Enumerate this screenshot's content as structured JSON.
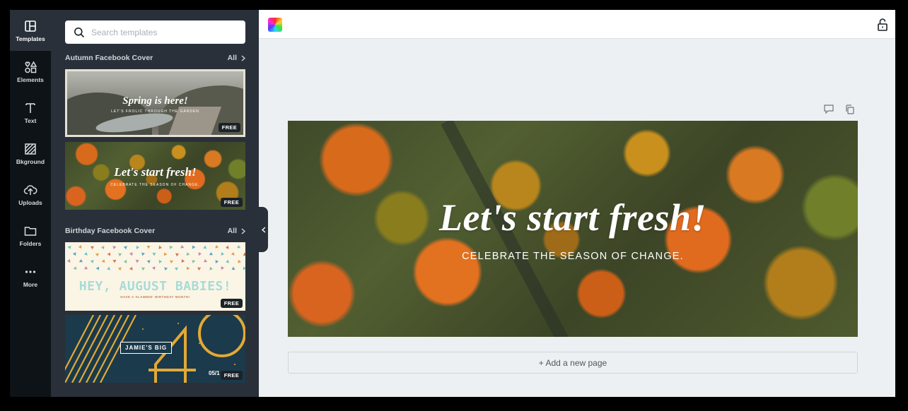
{
  "rail": {
    "items": [
      {
        "label": "Templates",
        "icon": "templates-icon",
        "active": true
      },
      {
        "label": "Elements",
        "icon": "elements-icon"
      },
      {
        "label": "Text",
        "icon": "text-icon"
      },
      {
        "label": "Bkground",
        "icon": "background-icon"
      },
      {
        "label": "Uploads",
        "icon": "upload-icon"
      },
      {
        "label": "Folders",
        "icon": "folder-icon"
      },
      {
        "label": "More",
        "icon": "more-icon"
      }
    ]
  },
  "search": {
    "placeholder": "Search templates"
  },
  "sections": [
    {
      "title": "Autumn Facebook Cover",
      "see_all": "All",
      "templates": [
        {
          "title": "Spring is here!",
          "subtitle": "LET'S FROLIC THROUGH THE GARDEN",
          "badge": "FREE"
        },
        {
          "title": "Let's start fresh!",
          "subtitle": "CELEBRATE THE SEASON OF CHANGE.",
          "badge": "FREE"
        }
      ]
    },
    {
      "title": "Birthday Facebook Cover",
      "see_all": "All",
      "templates": [
        {
          "title": "HEY, AUGUST BABIES!",
          "subtitle": "HAVE A SLAMMIN' BIRTHDAY MONTH!",
          "badge": "FREE"
        },
        {
          "title": "JAMIE'S BIG",
          "number": "40",
          "date": "05/1",
          "badge": "FREE"
        }
      ]
    }
  ],
  "canvas": {
    "title": "Let's start fresh!",
    "subtitle": "CELEBRATE THE SEASON OF CHANGE."
  },
  "add_page": "+ Add a new page",
  "colors": {
    "rail_bg": "#0e1318",
    "panel_bg": "#293039",
    "workspace_bg": "#edf0f2",
    "accent_orange": "#e06b1f"
  }
}
